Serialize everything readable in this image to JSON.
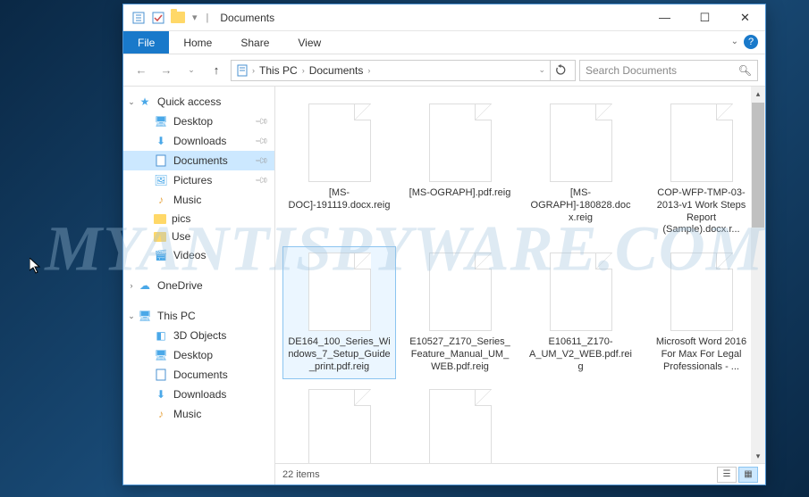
{
  "window": {
    "title": "Documents"
  },
  "ribbon": {
    "tabs": [
      "File",
      "Home",
      "Share",
      "View"
    ]
  },
  "breadcrumb": {
    "parts": [
      "This PC",
      "Documents"
    ]
  },
  "search": {
    "placeholder": "Search Documents"
  },
  "sidebar": {
    "quick_access": {
      "label": "Quick access",
      "items": [
        {
          "label": "Desktop",
          "icon": "monitor",
          "pinned": true
        },
        {
          "label": "Downloads",
          "icon": "download",
          "pinned": true
        },
        {
          "label": "Documents",
          "icon": "doc",
          "pinned": true,
          "selected": true
        },
        {
          "label": "Pictures",
          "icon": "picture",
          "pinned": true
        },
        {
          "label": "Music",
          "icon": "music",
          "pinned": false
        },
        {
          "label": "pics",
          "icon": "folder",
          "pinned": false
        },
        {
          "label": "Use",
          "icon": "folder",
          "pinned": false
        },
        {
          "label": "Videos",
          "icon": "video",
          "pinned": false
        }
      ]
    },
    "onedrive": {
      "label": "OneDrive"
    },
    "thispc": {
      "label": "This PC",
      "items": [
        {
          "label": "3D Objects"
        },
        {
          "label": "Desktop"
        },
        {
          "label": "Documents"
        },
        {
          "label": "Downloads"
        },
        {
          "label": "Music"
        }
      ]
    }
  },
  "files": [
    {
      "name": "[MS-DOC]-191119.docx.reig"
    },
    {
      "name": "[MS-OGRAPH].pdf.reig"
    },
    {
      "name": "[MS-OGRAPH]-180828.docx.reig"
    },
    {
      "name": "COP-WFP-TMP-03-2013-v1 Work Steps Report (Sample).docx.r..."
    },
    {
      "name": "DE164_100_Series_Windows_7_Setup_Guide_print.pdf.reig",
      "selected": true
    },
    {
      "name": "E10527_Z170_Series_Feature_Manual_UM_WEB.pdf.reig"
    },
    {
      "name": "E10611_Z170-A_UM_V2_WEB.pdf.reig"
    },
    {
      "name": "Microsoft Word 2016 For Max For Legal Professionals - ..."
    },
    {
      "name": ""
    },
    {
      "name": ""
    }
  ],
  "status": {
    "count": "22 items"
  },
  "watermark": "MYANTISPYWARE.COM"
}
